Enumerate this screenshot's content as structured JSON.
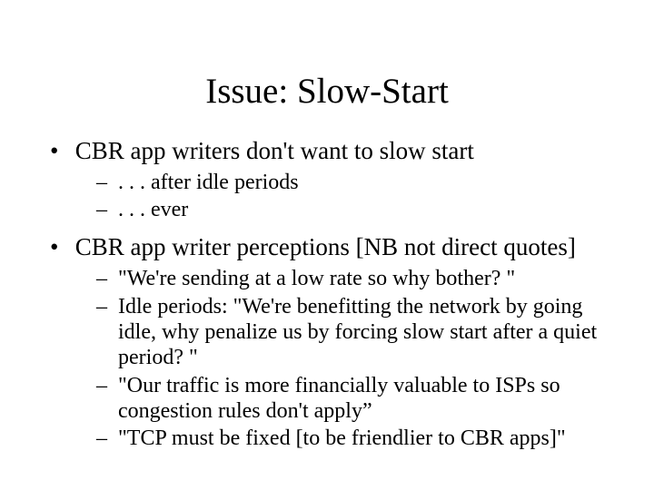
{
  "title": "Issue: Slow-Start",
  "bullets": [
    {
      "text": "CBR app writers don't want to slow start",
      "sub": [
        ". . . after idle periods",
        ". . . ever"
      ]
    },
    {
      "text": "CBR app writer perceptions [NB not direct quotes]",
      "sub": [
        "\"We're sending at a low rate so why bother? \"",
        "Idle periods: \"We're benefitting the network by going idle, why penalize us by forcing slow start after a quiet period? \"",
        "\"Our traffic is more financially valuable to ISPs so congestion rules don't apply”",
        "\"TCP must be fixed [to be friendlier to CBR apps]\""
      ]
    }
  ]
}
